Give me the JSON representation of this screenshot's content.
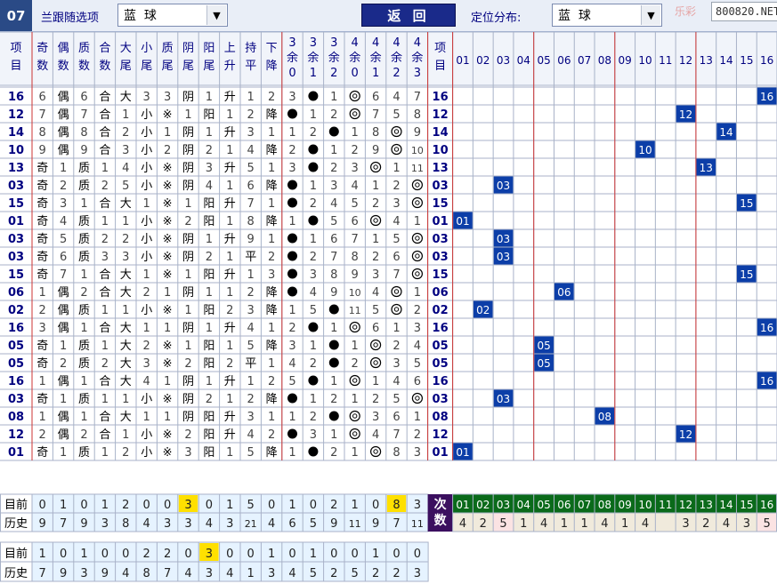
{
  "toolbar": {
    "issue_label": "07",
    "follow_label": "兰跟随选项",
    "ball_select_value": "蓝  球",
    "back_label": "返 回",
    "position_label": "定位分布:",
    "position_select_value": "蓝  球",
    "watermark_text": "乐彩",
    "watermark_site": "800820.NET"
  },
  "columns": {
    "item_header_chars": [
      "项",
      "目"
    ],
    "attr_headers": [
      [
        "奇",
        "数"
      ],
      [
        "偶",
        "数"
      ],
      [
        "质",
        "数"
      ],
      [
        "合",
        "数"
      ],
      [
        "大",
        "尾"
      ],
      [
        "小",
        "尾"
      ],
      [
        "质",
        "尾"
      ],
      [
        "阴",
        "尾"
      ],
      [
        "阳",
        "尾"
      ],
      [
        "上",
        "升"
      ],
      [
        "持",
        "平"
      ],
      [
        "下",
        "降"
      ],
      [
        "3",
        "余",
        "0"
      ],
      [
        "3",
        "余",
        "1"
      ],
      [
        "3",
        "余",
        "2"
      ],
      [
        "4",
        "余",
        "0"
      ],
      [
        "4",
        "余",
        "1"
      ],
      [
        "4",
        "余",
        "2"
      ],
      [
        "4",
        "余",
        "3"
      ]
    ],
    "dist_headers": [
      "01",
      "02",
      "03",
      "04",
      "05",
      "06",
      "07",
      "08",
      "09",
      "10",
      "11",
      "12",
      "13",
      "14",
      "15",
      "16"
    ]
  },
  "rows": [
    {
      "n": "16",
      "c": [
        "6",
        "偶",
        "6",
        "合",
        "大",
        "3",
        "3",
        "阴",
        "1",
        "升",
        "1",
        "2",
        "3",
        "●",
        "1",
        "◎",
        "6",
        "4",
        "7"
      ]
    },
    {
      "n": "12",
      "c": [
        "7",
        "偶",
        "7",
        "合",
        "1",
        "小",
        "※",
        "1",
        "阳",
        "1",
        "2",
        "降",
        "●",
        "1",
        "2",
        "◎",
        "7",
        "5",
        "8"
      ]
    },
    {
      "n": "14",
      "c": [
        "8",
        "偶",
        "8",
        "合",
        "2",
        "小",
        "1",
        "阴",
        "1",
        "升",
        "3",
        "1",
        "1",
        "2",
        "●",
        "1",
        "8",
        "◎",
        "9"
      ]
    },
    {
      "n": "10",
      "c": [
        "9",
        "偶",
        "9",
        "合",
        "3",
        "小",
        "2",
        "阴",
        "2",
        "1",
        "4",
        "降",
        "2",
        "●",
        "1",
        "2",
        "9",
        "◎",
        "10"
      ]
    },
    {
      "n": "13",
      "c": [
        "奇",
        "1",
        "质",
        "1",
        "4",
        "小",
        "※",
        "阴",
        "3",
        "升",
        "5",
        "1",
        "3",
        "●",
        "2",
        "3",
        "◎",
        "1",
        "11"
      ]
    },
    {
      "n": "03",
      "c": [
        "奇",
        "2",
        "质",
        "2",
        "5",
        "小",
        "※",
        "阴",
        "4",
        "1",
        "6",
        "降",
        "●",
        "1",
        "3",
        "4",
        "1",
        "2",
        "◎"
      ]
    },
    {
      "n": "15",
      "c": [
        "奇",
        "3",
        "1",
        "合",
        "大",
        "1",
        "※",
        "1",
        "阳",
        "升",
        "7",
        "1",
        "●",
        "2",
        "4",
        "5",
        "2",
        "3",
        "◎"
      ]
    },
    {
      "n": "01",
      "c": [
        "奇",
        "4",
        "质",
        "1",
        "1",
        "小",
        "※",
        "2",
        "阳",
        "1",
        "8",
        "降",
        "1",
        "●",
        "5",
        "6",
        "◎",
        "4",
        "1"
      ]
    },
    {
      "n": "03",
      "c": [
        "奇",
        "5",
        "质",
        "2",
        "2",
        "小",
        "※",
        "阴",
        "1",
        "升",
        "9",
        "1",
        "●",
        "1",
        "6",
        "7",
        "1",
        "5",
        "◎"
      ]
    },
    {
      "n": "03",
      "c": [
        "奇",
        "6",
        "质",
        "3",
        "3",
        "小",
        "※",
        "阴",
        "2",
        "1",
        "平",
        "2",
        "●",
        "2",
        "7",
        "8",
        "2",
        "6",
        "◎"
      ]
    },
    {
      "n": "15",
      "c": [
        "奇",
        "7",
        "1",
        "合",
        "大",
        "1",
        "※",
        "1",
        "阳",
        "升",
        "1",
        "3",
        "●",
        "3",
        "8",
        "9",
        "3",
        "7",
        "◎"
      ]
    },
    {
      "n": "06",
      "c": [
        "1",
        "偶",
        "2",
        "合",
        "大",
        "2",
        "1",
        "阴",
        "1",
        "1",
        "2",
        "降",
        "●",
        "4",
        "9",
        "10",
        "4",
        "◎",
        "1"
      ]
    },
    {
      "n": "02",
      "c": [
        "2",
        "偶",
        "质",
        "1",
        "1",
        "小",
        "※",
        "1",
        "阳",
        "2",
        "3",
        "降",
        "1",
        "5",
        "●",
        "11",
        "5",
        "◎",
        "2"
      ]
    },
    {
      "n": "16",
      "c": [
        "3",
        "偶",
        "1",
        "合",
        "大",
        "1",
        "1",
        "阴",
        "1",
        "升",
        "4",
        "1",
        "2",
        "●",
        "1",
        "◎",
        "6",
        "1",
        "3"
      ]
    },
    {
      "n": "05",
      "c": [
        "奇",
        "1",
        "质",
        "1",
        "大",
        "2",
        "※",
        "1",
        "阳",
        "1",
        "5",
        "降",
        "3",
        "1",
        "●",
        "1",
        "◎",
        "2",
        "4"
      ]
    },
    {
      "n": "05",
      "c": [
        "奇",
        "2",
        "质",
        "2",
        "大",
        "3",
        "※",
        "2",
        "阳",
        "2",
        "平",
        "1",
        "4",
        "2",
        "●",
        "2",
        "◎",
        "3",
        "5"
      ]
    },
    {
      "n": "16",
      "c": [
        "1",
        "偶",
        "1",
        "合",
        "大",
        "4",
        "1",
        "阴",
        "1",
        "升",
        "1",
        "2",
        "5",
        "●",
        "1",
        "◎",
        "1",
        "4",
        "6"
      ]
    },
    {
      "n": "03",
      "c": [
        "奇",
        "1",
        "质",
        "1",
        "1",
        "小",
        "※",
        "阴",
        "2",
        "1",
        "2",
        "降",
        "●",
        "1",
        "2",
        "1",
        "2",
        "5",
        "◎"
      ]
    },
    {
      "n": "08",
      "c": [
        "1",
        "偶",
        "1",
        "合",
        "大",
        "1",
        "1",
        "阴",
        "阳",
        "升",
        "3",
        "1",
        "1",
        "2",
        "●",
        "◎",
        "3",
        "6",
        "1"
      ]
    },
    {
      "n": "12",
      "c": [
        "2",
        "偶",
        "2",
        "合",
        "1",
        "小",
        "※",
        "2",
        "阳",
        "升",
        "4",
        "2",
        "●",
        "3",
        "1",
        "◎",
        "4",
        "7",
        "2"
      ]
    },
    {
      "n": "01",
      "c": [
        "奇",
        "1",
        "质",
        "1",
        "2",
        "小",
        "※",
        "3",
        "阳",
        "1",
        "5",
        "降",
        "1",
        "●",
        "2",
        "1",
        "◎",
        "8",
        "3"
      ]
    }
  ],
  "stats1": {
    "current_label": "目前",
    "history_label": "历史",
    "current": [
      "0",
      "1",
      "0",
      "1",
      "2",
      "0",
      "0",
      "3",
      "0",
      "1",
      "5",
      "0",
      "1",
      "0",
      "2",
      "1",
      "0",
      "8",
      "3"
    ],
    "history": [
      "9",
      "7",
      "9",
      "3",
      "8",
      "4",
      "3",
      "3",
      "4",
      "3",
      "21",
      "4",
      "6",
      "5",
      "9",
      "11",
      "9",
      "7",
      "11"
    ],
    "highlight_current": [
      7,
      17
    ]
  },
  "counts": {
    "label_chars": [
      "次",
      "数"
    ],
    "numbers": [
      "01",
      "02",
      "03",
      "04",
      "05",
      "06",
      "07",
      "08",
      "09",
      "10",
      "11",
      "12",
      "13",
      "14",
      "15",
      "16"
    ],
    "values": [
      "4",
      "2",
      "5",
      "1",
      "4",
      "1",
      "1",
      "4",
      "1",
      "4",
      "",
      "3",
      "2",
      "4",
      "3",
      "5"
    ]
  },
  "stats2": {
    "current_label": "目前",
    "history_label": "历史",
    "current": [
      "1",
      "0",
      "1",
      "0",
      "0",
      "2",
      "2",
      "0",
      "3",
      "0",
      "0",
      "1",
      "0",
      "1",
      "0",
      "0",
      "1",
      "0",
      "0"
    ],
    "history": [
      "7",
      "9",
      "3",
      "9",
      "4",
      "8",
      "7",
      "4",
      "3",
      "4",
      "1",
      "3",
      "4",
      "5",
      "2",
      "5",
      "2",
      "2",
      "3"
    ],
    "highlight_current": [
      8
    ]
  },
  "colors": {
    "grid_line": "#a8b2c8",
    "red_line": "#cc3333",
    "header_bg": "#f1f4fa",
    "item_text": "#000080",
    "number_box": "#0c3ea8",
    "number_text": "#ffffff",
    "stats_bg": "#e6f3ff",
    "highlight": "#ffe000",
    "counts_label_bg": "#3b0f5f",
    "counts_header_bg": "#0a6a1a",
    "counts_value_bg": "#f0eadc",
    "counts_peak_bg": "#fbe3e3"
  }
}
